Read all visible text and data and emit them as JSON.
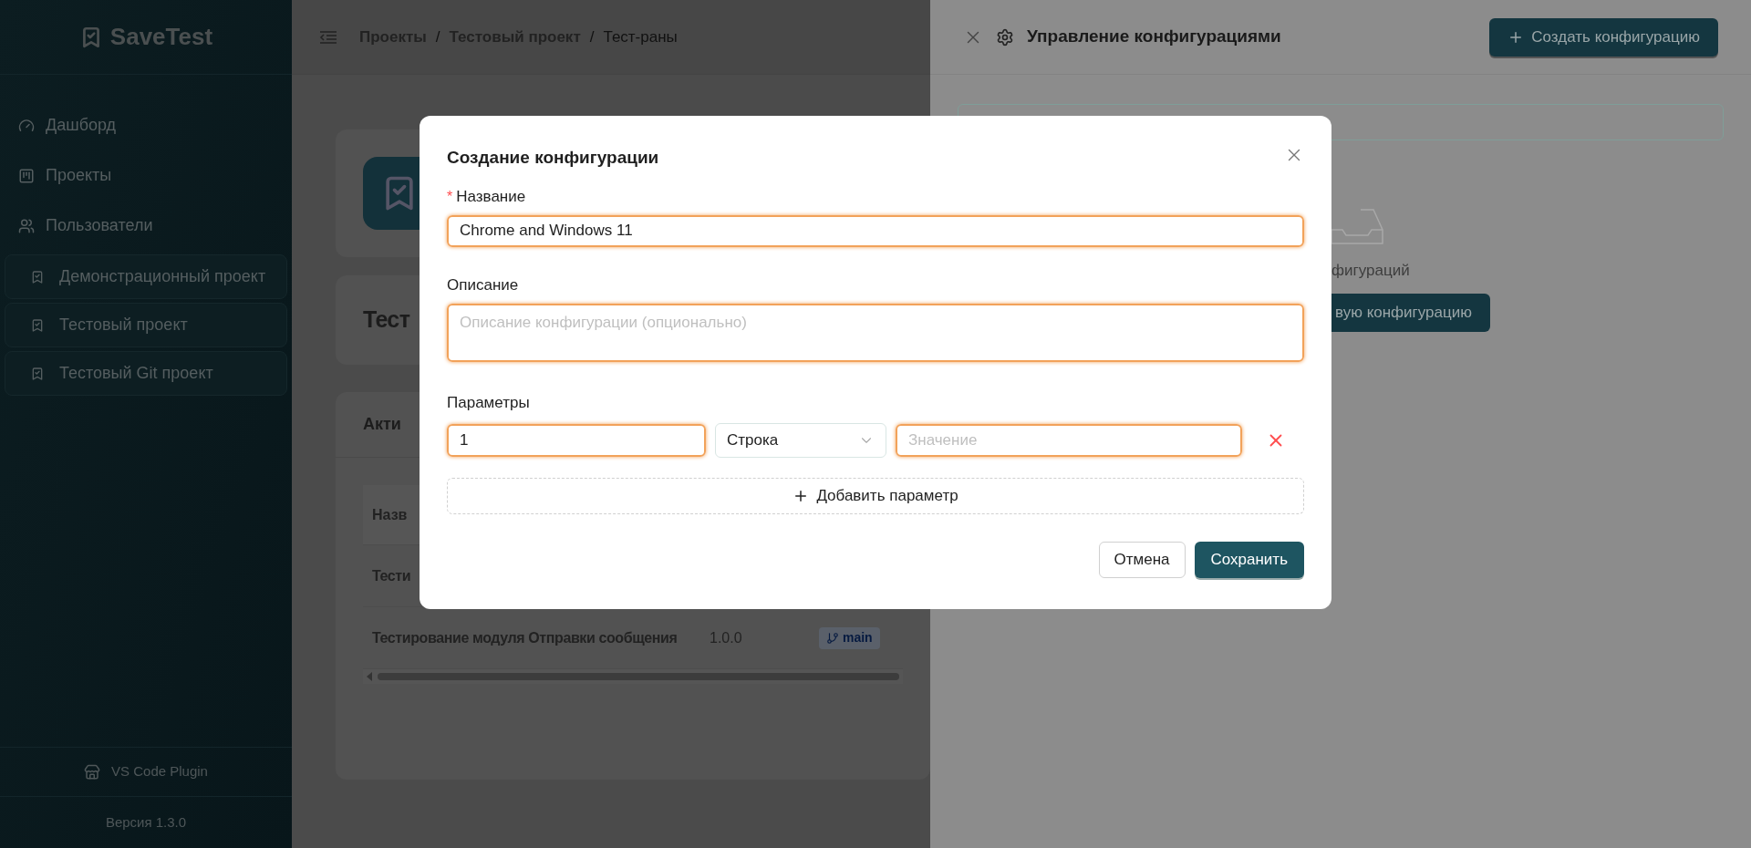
{
  "sidebar": {
    "logo": "SaveTest",
    "nav": [
      {
        "label": "Дашборд",
        "kind": "dashboard"
      },
      {
        "label": "Проекты",
        "kind": "projects"
      },
      {
        "label": "Пользователи",
        "kind": "users"
      }
    ],
    "projects": [
      {
        "label": "Демонстрационный проект"
      },
      {
        "label": "Тестовый проект"
      },
      {
        "label": "Тестовый Git проект"
      }
    ],
    "plugin": "VS Code Plugin",
    "version": "Версия 1.3.0"
  },
  "header": {
    "breadcrumbs": [
      "Проекты",
      "Тестовый проект",
      "Тест-раны"
    ],
    "separator": "/"
  },
  "page": {
    "card_title": "Тест",
    "section_title": "Акти",
    "table_header": "Назв",
    "rows": [
      {
        "name": "Тести"
      },
      {
        "name": "Тестирование модуля Отправки сообщения",
        "version": "1.0.0",
        "branch": "main"
      }
    ]
  },
  "drawer": {
    "title": "Управление конфигурациями",
    "create_button": "Создать конфигурацию",
    "empty_text": "фигураций",
    "empty_button": "вую конфигурацию"
  },
  "modal": {
    "title": "Создание конфигурации",
    "required_symbol": "*",
    "fields": [
      {
        "label": "Название",
        "required": true,
        "kind": "input",
        "value": "Chrome and Windows 11",
        "highlighted": true
      },
      {
        "label": "Описание",
        "required": false,
        "kind": "textarea",
        "placeholder": "Описание конфигурации (опционально)",
        "highlighted": true
      }
    ],
    "parameters_label": "Параметры",
    "parameters": [
      {
        "key": {
          "value": "1",
          "highlighted": true
        },
        "type": {
          "value": "Строка",
          "highlighted": false
        },
        "value": {
          "placeholder": "Значение",
          "highlighted": true
        }
      }
    ],
    "add_button": "Добавить параметр",
    "cancel": "Отмена",
    "save": "Сохранить"
  }
}
